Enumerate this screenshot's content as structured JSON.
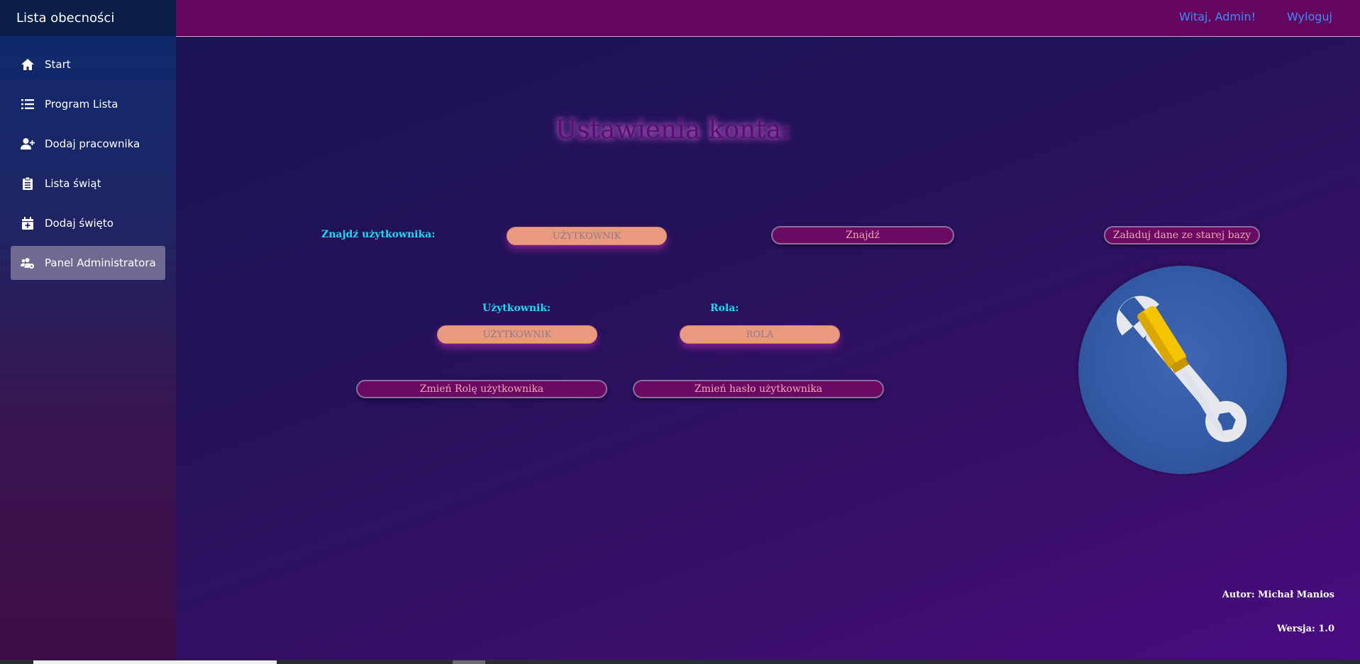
{
  "sidebar": {
    "title": "Lista obecności",
    "items": [
      {
        "label": "Start",
        "icon": "home-icon"
      },
      {
        "label": "Program Lista",
        "icon": "list-icon"
      },
      {
        "label": "Dodaj pracownika",
        "icon": "user-plus-icon"
      },
      {
        "label": "Lista świąt",
        "icon": "clipboard-icon"
      },
      {
        "label": "Dodaj święto",
        "icon": "calendar-plus-icon"
      },
      {
        "label": "Panel Administratora",
        "icon": "users-cog-icon",
        "active": true
      }
    ]
  },
  "topbar": {
    "greeting": "Witaj, Admin!",
    "logout": "Wyloguj"
  },
  "main": {
    "title": "Ustawienia konta:",
    "find_label": "Znajdź użytkownika:",
    "find_input": "UŻYTKOWNIK",
    "find_button": "Znajdź",
    "load_button": "Załaduj dane ze starej bazy",
    "user_label": "Użytkownik:",
    "user_input": "UŻYTKOWNIK",
    "role_label": "Rola:",
    "role_input": "ROLA",
    "change_role_button": "Zmień Rolę użytkownika",
    "change_password_button": "Zmień hasło użytkownika",
    "tools_icon": "tools-icon"
  },
  "footer": {
    "author": "Autor: Michał Manios",
    "version": "Wersja: 1.0"
  },
  "colors": {
    "accent_cyan": "#27d6f5",
    "topbar": "#65065e",
    "link": "#3b8cff",
    "input_fill": "#e99a7f",
    "button_fill": "#6a0a62"
  }
}
